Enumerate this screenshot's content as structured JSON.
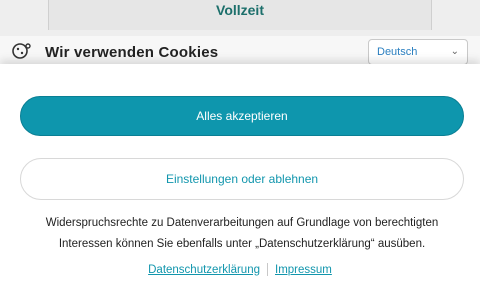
{
  "background": {
    "card_title": "Vollzeit"
  },
  "cookie_header": {
    "title": "Wir verwenden Cookies",
    "icon": "cookie-icon",
    "language": {
      "selected": "Deutsch",
      "icon": "chevron-down-icon"
    }
  },
  "banner": {
    "accept_all_label": "Alles akzeptieren",
    "settings_label": "Einstellungen oder ablehnen",
    "info_text": "Widerspruchsrechte zu Datenverarbeitungen auf Grundlage von berechtigten Interessen können Sie ebenfalls unter „Datenschutzerklärung“ ausüben.",
    "links": [
      {
        "label": "Datenschutzerklärung"
      },
      {
        "label": "Impressum"
      }
    ]
  },
  "colors": {
    "accent": "#0e96ad",
    "link": "#1296ad",
    "text": "#222222"
  }
}
